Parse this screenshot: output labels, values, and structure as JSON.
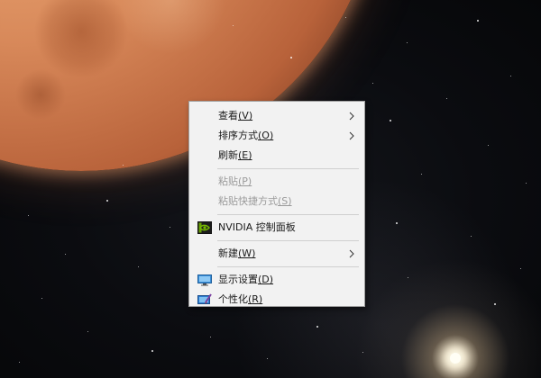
{
  "context_menu": {
    "items": [
      {
        "label": "查看",
        "accel": "(V)",
        "submenu": true,
        "disabled": false
      },
      {
        "label": "排序方式",
        "accel": "(O)",
        "submenu": true,
        "disabled": false
      },
      {
        "label": "刷新",
        "accel": "(E)",
        "submenu": false,
        "disabled": false
      },
      {
        "label": "粘贴",
        "accel": "(P)",
        "submenu": false,
        "disabled": true
      },
      {
        "label": "粘贴快捷方式",
        "accel": "(S)",
        "submenu": false,
        "disabled": true
      },
      {
        "label": "NVIDIA 控制面板",
        "accel": "",
        "submenu": false,
        "disabled": false,
        "icon": "nvidia-icon"
      },
      {
        "label": "新建",
        "accel": "(W)",
        "submenu": true,
        "disabled": false
      },
      {
        "label": "显示设置",
        "accel": "(D)",
        "submenu": false,
        "disabled": false,
        "icon": "display-settings-icon"
      },
      {
        "label": "个性化",
        "accel": "(R)",
        "submenu": false,
        "disabled": false,
        "icon": "personalize-icon"
      }
    ]
  },
  "colors": {
    "menu_background": "#f2f2f2",
    "menu_border": "#a0a0a0",
    "text": "#1a1a1a",
    "disabled_text": "#9a9a9a",
    "separator": "#cfcfcf",
    "nvidia_green": "#76b900",
    "display_icon_blue": "#3a8fd8"
  },
  "wallpaper": {
    "description_icons": [
      "planet",
      "stars",
      "bright-star"
    ]
  }
}
